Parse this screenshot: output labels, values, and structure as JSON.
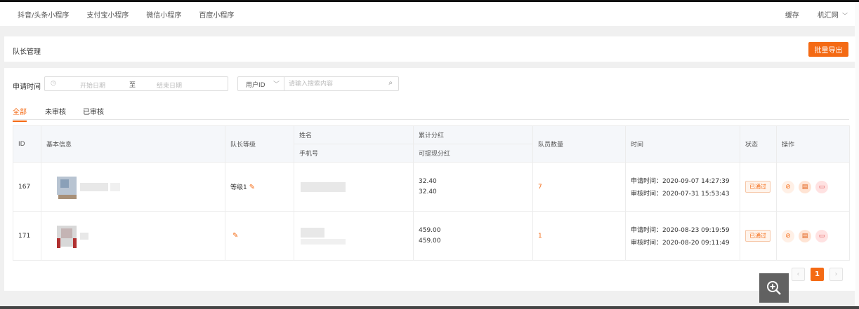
{
  "topnav": {
    "tabs": [
      "抖音/头条小程序",
      "支付宝小程序",
      "微信小程序",
      "百度小程序"
    ],
    "cache": "缓存",
    "account": "机汇网",
    "account_chevron": "﹀"
  },
  "header": {
    "title": "队长管理",
    "export_label": "批量导出"
  },
  "filter": {
    "time_label": "申请时间",
    "start_placeholder": "开始日期",
    "separator": "至",
    "end_placeholder": "结束日期",
    "select_value": "用户ID",
    "search_placeholder": "请输入搜索内容"
  },
  "tabs": [
    "全部",
    "未审核",
    "已审核"
  ],
  "table": {
    "headers": {
      "id": "ID",
      "info": "基本信息",
      "level": "队长等级",
      "name": "姓名",
      "phone": "手机号",
      "total": "累计分红",
      "withdrawable": "可提现分红",
      "members": "队员数量",
      "time": "时间",
      "status": "状态",
      "ops": "操作"
    },
    "rows": [
      {
        "id": "167",
        "level": "等级1",
        "total": "32.40",
        "withdrawable": "32.40",
        "members": "7",
        "apply_time": "申请时间：2020-09-07 14:27:39",
        "review_time": "审核时间：2020-07-31 15:53:43",
        "status": "已通过"
      },
      {
        "id": "171",
        "level": "",
        "total": "459.00",
        "withdrawable": "459.00",
        "members": "1",
        "apply_time": "申请时间：2020-08-23 09:19:59",
        "review_time": "审核时间：2020-08-20 09:11:49",
        "status": "已通过"
      }
    ]
  },
  "pager": {
    "prev": "‹",
    "current": "1",
    "next": "›"
  },
  "colors": {
    "accent": "#f46a14"
  }
}
